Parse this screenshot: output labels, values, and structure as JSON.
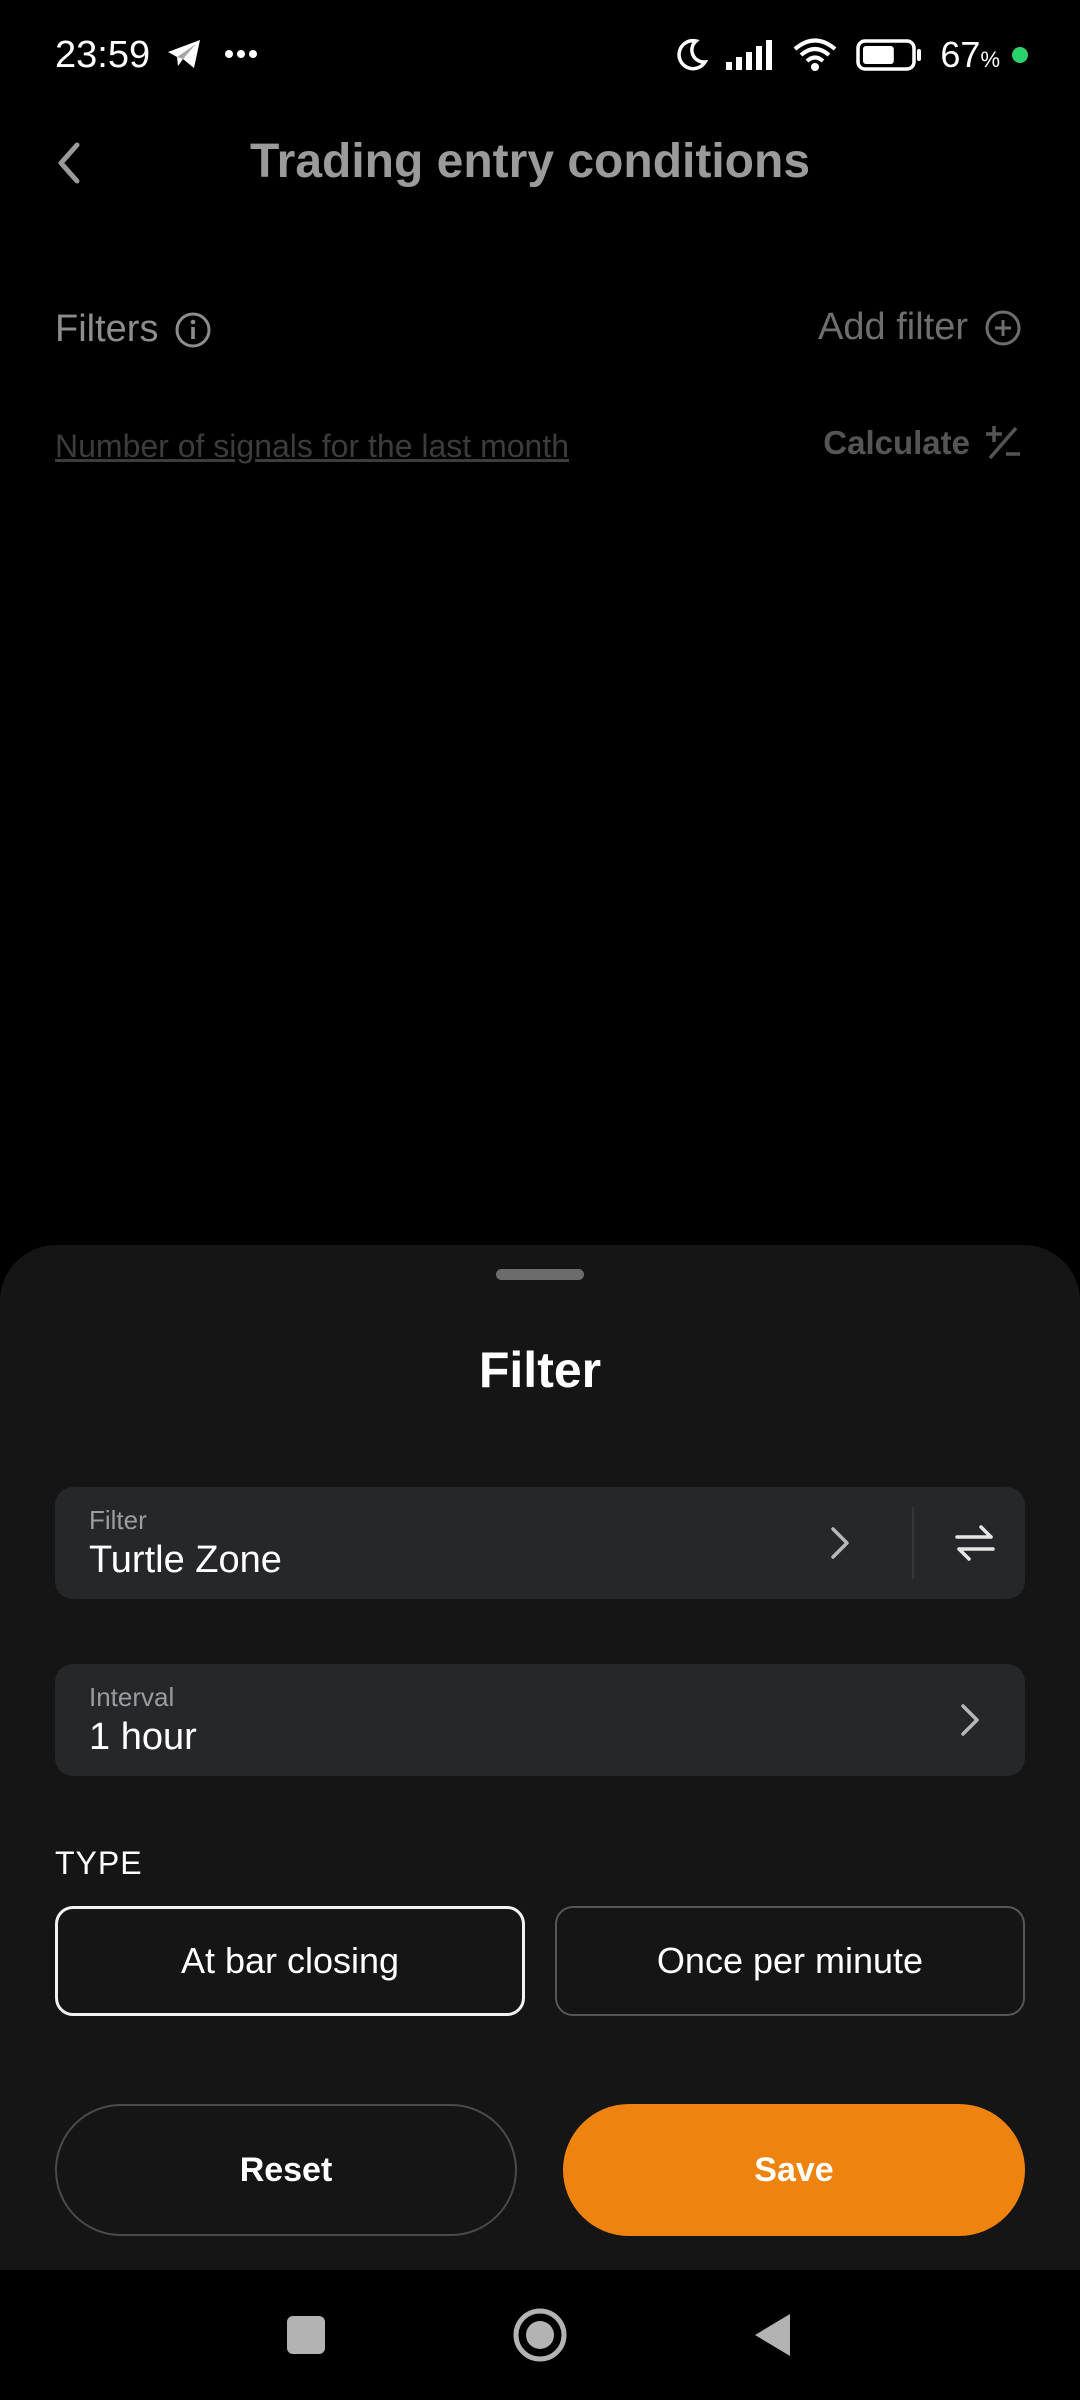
{
  "status_bar": {
    "time": "23:59",
    "battery_percent": "67",
    "battery_unit": "%",
    "battery_level": 67,
    "icons": [
      "telegram-icon",
      "more-dots-icon",
      "moon-icon",
      "signal-icon",
      "wifi-icon",
      "battery-icon"
    ]
  },
  "header": {
    "title": "Trading entry conditions"
  },
  "filters_section": {
    "label": "Filters",
    "add_filter_label": "Add filter",
    "signals_link": "Number of signals for the last month",
    "calculate_label": "Calculate"
  },
  "sheet": {
    "title": "Filter",
    "filter_field": {
      "label": "Filter",
      "value": "Turtle Zone"
    },
    "interval_field": {
      "label": "Interval",
      "value": "1 hour"
    },
    "type_label": "TYPE",
    "type_options": [
      {
        "label": "At bar closing",
        "selected": true
      },
      {
        "label": "Once per minute",
        "selected": false
      }
    ],
    "reset_label": "Reset",
    "save_label": "Save"
  },
  "colors": {
    "accent": "#ee8310",
    "sheet_bg": "#151515",
    "field_bg": "#26272b"
  }
}
